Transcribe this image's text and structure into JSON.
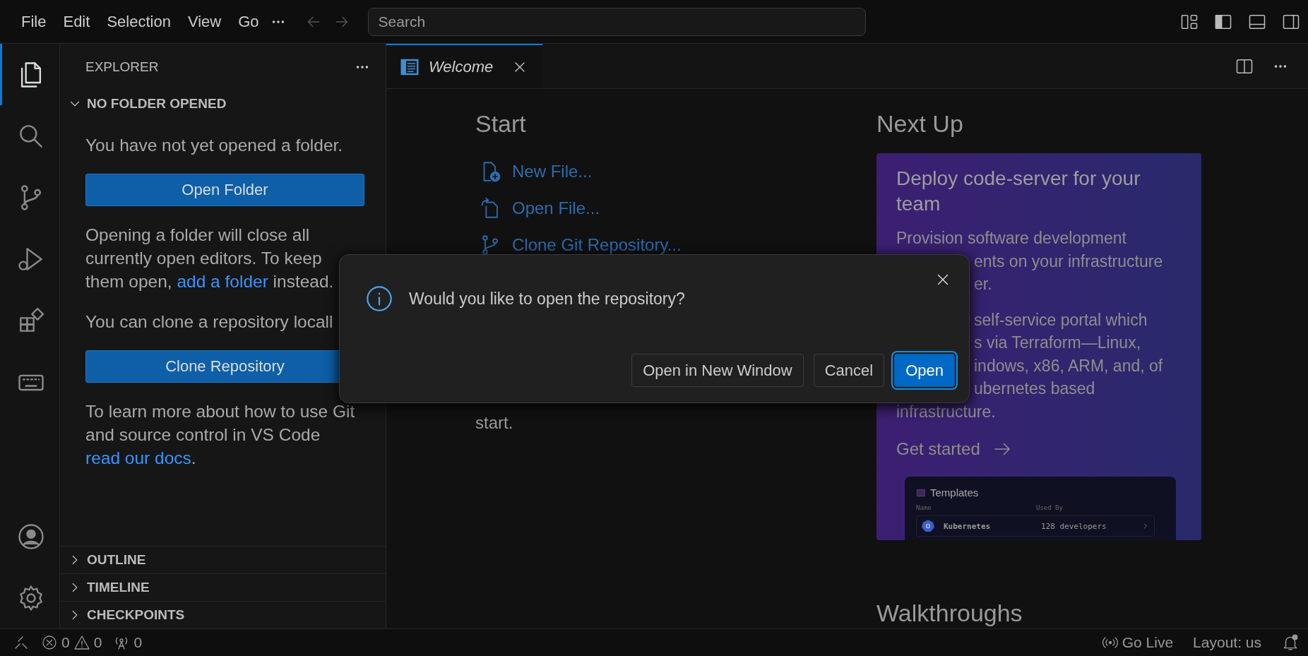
{
  "menu_bar": {
    "items": [
      "File",
      "Edit",
      "Selection",
      "View",
      "Go"
    ],
    "search": {
      "placeholder": "Search"
    }
  },
  "activity_bar": {
    "top": [
      {
        "kind": "files",
        "selected": true
      },
      {
        "kind": "search",
        "selected": false
      },
      {
        "kind": "source-control",
        "selected": false
      },
      {
        "kind": "run-debug",
        "selected": false
      },
      {
        "kind": "extensions",
        "selected": false
      },
      {
        "kind": "keyboard",
        "selected": false
      }
    ],
    "bottom": [
      {
        "kind": "account",
        "selected": false
      },
      {
        "kind": "settings",
        "selected": false
      }
    ]
  },
  "sidebar": {
    "title": "EXPLORER",
    "sections": [
      {
        "title": "NO FOLDER OPENED",
        "expanded": true,
        "content": [
          {
            "kind": "paragraph",
            "segments": [
              {
                "text": "You have not yet opened a folder.",
                "kind": "text"
              }
            ]
          },
          {
            "kind": "button",
            "label": "Open Folder"
          },
          {
            "kind": "paragraph",
            "segments": [
              {
                "text": "Opening a folder will close all currently open editors. To keep them open, ",
                "kind": "text"
              },
              {
                "text": "add a folder",
                "kind": "link"
              },
              {
                "text": " instead.",
                "kind": "text"
              }
            ]
          },
          {
            "kind": "paragraph",
            "segments": [
              {
                "text": "You can clone a repository locall",
                "kind": "text"
              }
            ]
          },
          {
            "kind": "button",
            "label": "Clone Repository"
          },
          {
            "kind": "paragraph",
            "segments": [
              {
                "text": "To learn more about how to use Git and source control in VS Code ",
                "kind": "text"
              },
              {
                "text": "read our docs",
                "kind": "link"
              },
              {
                "text": ".",
                "kind": "text"
              }
            ]
          }
        ]
      },
      {
        "title": "OUTLINE",
        "expanded": false
      },
      {
        "title": "TIMELINE",
        "expanded": false
      },
      {
        "title": "CHECKPOINTS",
        "expanded": false
      }
    ]
  },
  "editor": {
    "tabs": [
      {
        "label": "Welcome",
        "selected": true
      }
    ],
    "start": {
      "heading": "Start",
      "items": [
        {
          "kind": "new-file",
          "label": "New File..."
        },
        {
          "kind": "open-file",
          "label": "Open File..."
        },
        {
          "kind": "clone",
          "label": "Clone Git Repository..."
        }
      ],
      "trailing_text": "start."
    },
    "next_up": {
      "heading": "Next Up",
      "card": {
        "title": "Deploy code-server for your team",
        "paragraphs": [
          {
            "lines": [
              {
                "text": "Provision software development",
                "clipped": false
              },
              {
                "text": "ents on your infrastructure",
                "clipped": true
              },
              {
                "text": "er.",
                "clipped": true
              }
            ]
          },
          {
            "lines": [
              {
                "text": "self-service portal which",
                "clipped": true
              },
              {
                "text": "s via Terraform—Linux,",
                "clipped": true
              },
              {
                "text": "indows, x86, ARM, and, of",
                "clipped": true
              },
              {
                "text": "ubernetes based",
                "clipped": true
              },
              {
                "text": "infrastructure.",
                "clipped": false
              }
            ]
          }
        ],
        "link": "Get started",
        "preview": {
          "title": "Templates",
          "columns": [
            "Name",
            "Used By"
          ],
          "rows": [
            {
              "name": "Kubernetes",
              "used_by": "128 developers"
            }
          ]
        }
      }
    },
    "walkthroughs": {
      "heading": "Walkthroughs"
    }
  },
  "dialog": {
    "message": "Would you like to open the repository?",
    "buttons": [
      {
        "label": "Open in New Window",
        "primary": false
      },
      {
        "label": "Cancel",
        "primary": false
      },
      {
        "label": "Open",
        "primary": true
      }
    ]
  },
  "status_bar": {
    "errors": "0",
    "warnings": "0",
    "ports": "0",
    "right": [
      "Go Live",
      "Layout: us"
    ]
  }
}
